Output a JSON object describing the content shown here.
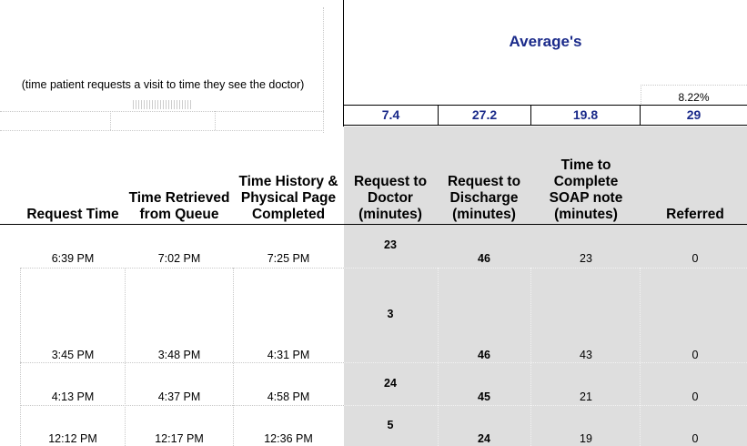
{
  "title": "Average's",
  "note": "(time patient requests a visit to time they see the doctor)",
  "averages": {
    "percent": "8.22%",
    "values": [
      "7.4",
      "27.2",
      "19.8",
      "29"
    ]
  },
  "colors": {
    "accent": "#1a2a8a",
    "shaded": "#dedede"
  },
  "columns": [
    "Request Time",
    "Time Retrieved from Queue",
    "Time History & Physical Page Completed",
    "Request to Doctor (minutes)",
    "Request to Discharge (minutes)",
    "Time to Complete SOAP note (minutes)",
    "Referred"
  ],
  "rows": [
    {
      "request_time": "6:39 PM",
      "retrieved": "7:02 PM",
      "hp_completed": "7:25 PM",
      "to_doctor": "23",
      "to_discharge": "46",
      "soap": "23",
      "referred": "0"
    },
    {
      "request_time": "3:45 PM",
      "retrieved": "3:48 PM",
      "hp_completed": "4:31 PM",
      "to_doctor": "3",
      "to_discharge": "46",
      "soap": "43",
      "referred": "0"
    },
    {
      "request_time": "4:13 PM",
      "retrieved": "4:37 PM",
      "hp_completed": "4:58 PM",
      "to_doctor": "24",
      "to_discharge": "45",
      "soap": "21",
      "referred": "0"
    },
    {
      "request_time": "12:12 PM",
      "retrieved": "12:17 PM",
      "hp_completed": "12:36 PM",
      "to_doctor": "5",
      "to_discharge": "24",
      "soap": "19",
      "referred": "0"
    }
  ]
}
